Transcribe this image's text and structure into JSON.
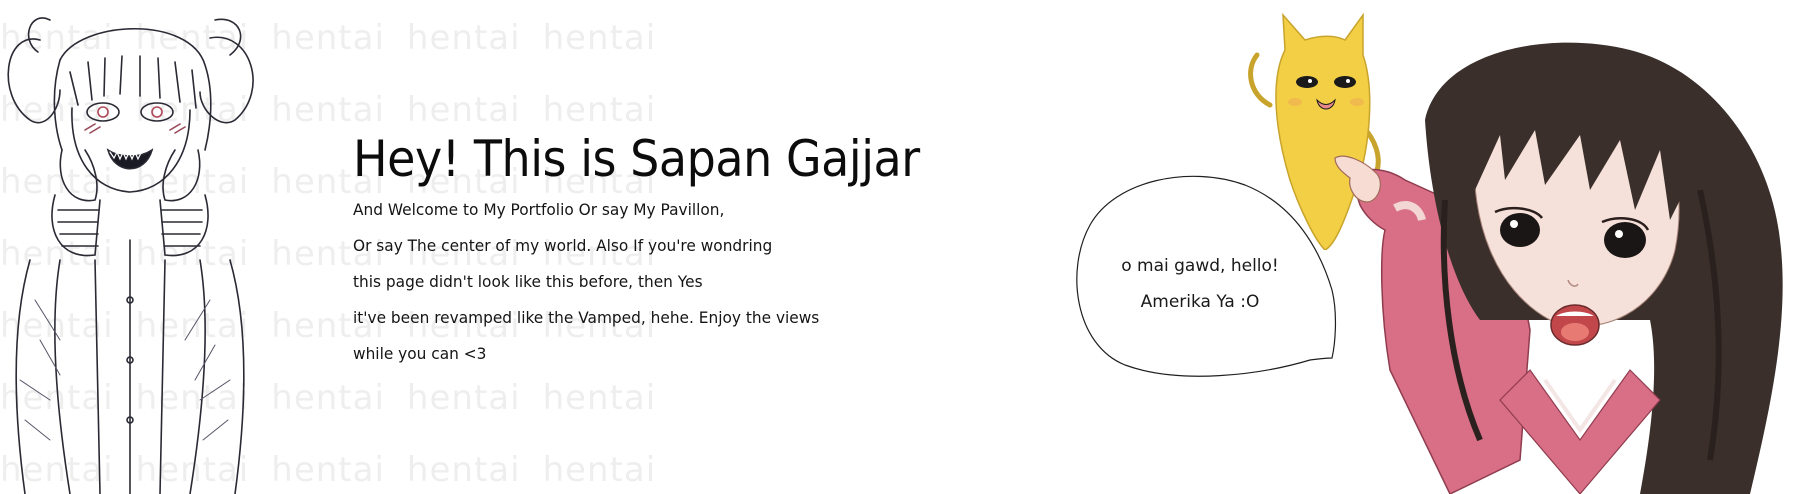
{
  "watermark": {
    "word": "hentai"
  },
  "intro": {
    "title": "Hey! This is Sapan Gajjar",
    "lines": [
      "And Welcome to My Portfolio Or say My Pavillon,",
      "Or say The center of my world. Also If you're wondring",
      "this page didn't look like this before, then Yes",
      "it've been revamped like the Vamped, hehe. Enjoy the views",
      "while you can <3"
    ]
  },
  "speech_bubble": {
    "line1": "o mai gawd, hello!",
    "line2": "Amerika Ya :O"
  },
  "colors": {
    "background": "#ffffff",
    "text": "#111111",
    "watermark": "#efefef",
    "cat_yellow": "#f2cf45",
    "girl_sweater": "#d96f86",
    "girl_hair": "#3a2f2b"
  }
}
